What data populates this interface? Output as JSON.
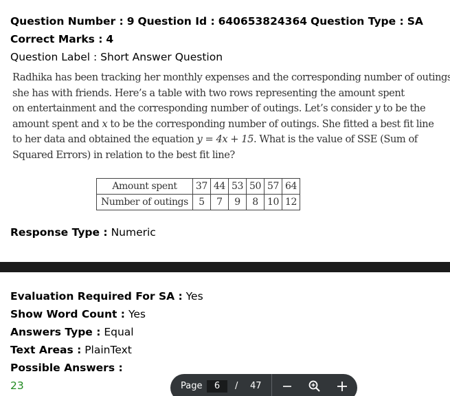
{
  "meta": {
    "line1": {
      "qnum_label": "Question Number :",
      "qnum_value": "9",
      "qid_label": "Question Id :",
      "qid_value": "640653824364",
      "qtype_label": "Question Type :",
      "qtype_value": "SA"
    },
    "marks_label": "Correct Marks :",
    "marks_value": "4",
    "qlabel_label": "Question Label :",
    "qlabel_value": "Short Answer Question"
  },
  "question": {
    "lines": [
      [
        "Radhika has been tracking her monthly expenses and the corresponding number of outings"
      ],
      [
        "she has with friends. Here’s a table with two rows representing the amount spent"
      ],
      [
        "on entertainment and the corresponding number of outings. Let’s consider ",
        "y",
        " to be the"
      ],
      [
        "amount spent and ",
        "x",
        " to be the corresponding number of outings. She fitted a best fit line"
      ],
      [
        "to her data and obtained the equation ",
        "y = 4x + 15",
        ". What is the value of SSE (Sum of"
      ],
      [
        "Squared Errors) in relation to the best fit line?"
      ]
    ]
  },
  "table": {
    "rows": [
      {
        "label": "Amount spent",
        "values": [
          "37",
          "44",
          "53",
          "50",
          "57",
          "64"
        ]
      },
      {
        "label": "Number of outings",
        "values": [
          "5",
          "7",
          "9",
          "8",
          "10",
          "12"
        ]
      }
    ]
  },
  "response": {
    "label": "Response Type :",
    "value": "Numeric"
  },
  "evaluation": {
    "eval_label": "Evaluation Required For SA :",
    "eval_value": "Yes",
    "wordcount_label": "Show Word Count :",
    "wordcount_value": "Yes",
    "anstype_label": "Answers Type :",
    "anstype_value": "Equal",
    "textareas_label": "Text Areas :",
    "textareas_value": "PlainText",
    "possible_label": "Possible Answers :",
    "answer": "23",
    "answer_color": "#218a21"
  },
  "pager": {
    "label": "Page",
    "current": "6",
    "separator": "/",
    "total": "47",
    "zoom_out_icon": "minus-icon",
    "zoom_fit_icon": "zoom-icon",
    "zoom_in_icon": "plus-icon"
  }
}
